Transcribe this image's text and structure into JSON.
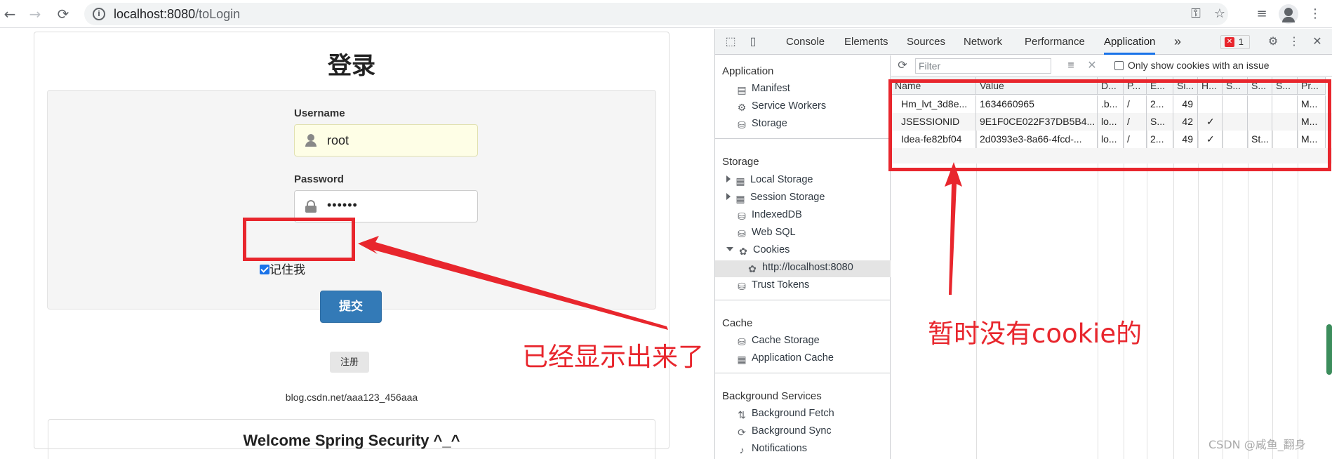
{
  "browser": {
    "url_host": "localhost:8080",
    "url_path": "/toLogin"
  },
  "login": {
    "title": "登录",
    "username_label": "Username",
    "username_value": "root",
    "password_label": "Password",
    "password_value": "••••••",
    "remember_label": "记住我",
    "submit_label": "提交",
    "register_label": "注册",
    "blog_link": "blog.csdn.net/aaa123_456aaa",
    "welcome": "Welcome Spring Security ^_^"
  },
  "annotations": {
    "left_note": "已经显示出来了",
    "right_note": "暂时没有cookie的",
    "watermark": "CSDN @咸鱼_翻身"
  },
  "devtools": {
    "tabs": [
      "Console",
      "Elements",
      "Sources",
      "Network",
      "Performance",
      "Application"
    ],
    "active_tab": "Application",
    "more_tabs": "»",
    "error_count": "1",
    "sidebar": {
      "application_header": "Application",
      "application_items": [
        "Manifest",
        "Service Workers",
        "Storage"
      ],
      "storage_header": "Storage",
      "storage_items": [
        "Local Storage",
        "Session Storage",
        "IndexedDB",
        "Web SQL",
        "Cookies"
      ],
      "cookies_origin": "http://localhost:8080",
      "trust_tokens": "Trust Tokens",
      "cache_header": "Cache",
      "cache_items": [
        "Cache Storage",
        "Application Cache"
      ],
      "bg_header": "Background Services",
      "bg_items": [
        "Background Fetch",
        "Background Sync",
        "Notifications"
      ]
    },
    "filter_placeholder": "Filter",
    "only_issue_label": "Only show cookies with an issue",
    "cookie_table": {
      "columns": [
        "Name",
        "Value",
        "D...",
        "P...",
        "E...",
        "Si...",
        "H...",
        "S...",
        "S...",
        "S...",
        "Pr..."
      ],
      "rows": [
        [
          "Hm_lvt_3d8e...",
          "1634660965",
          ".b...",
          "/",
          "2...",
          "49",
          "",
          "",
          "",
          "",
          "M..."
        ],
        [
          "JSESSIONID",
          "9E1F0CE022F37DB5B4...",
          "lo...",
          "/",
          "S...",
          "42",
          "✓",
          "",
          "",
          "",
          "M..."
        ],
        [
          "Idea-fe82bf04",
          "2d0393e3-8a66-4fcd-...",
          "lo...",
          "/",
          "2...",
          "49",
          "✓",
          "",
          "St...",
          "",
          "M..."
        ]
      ]
    }
  }
}
